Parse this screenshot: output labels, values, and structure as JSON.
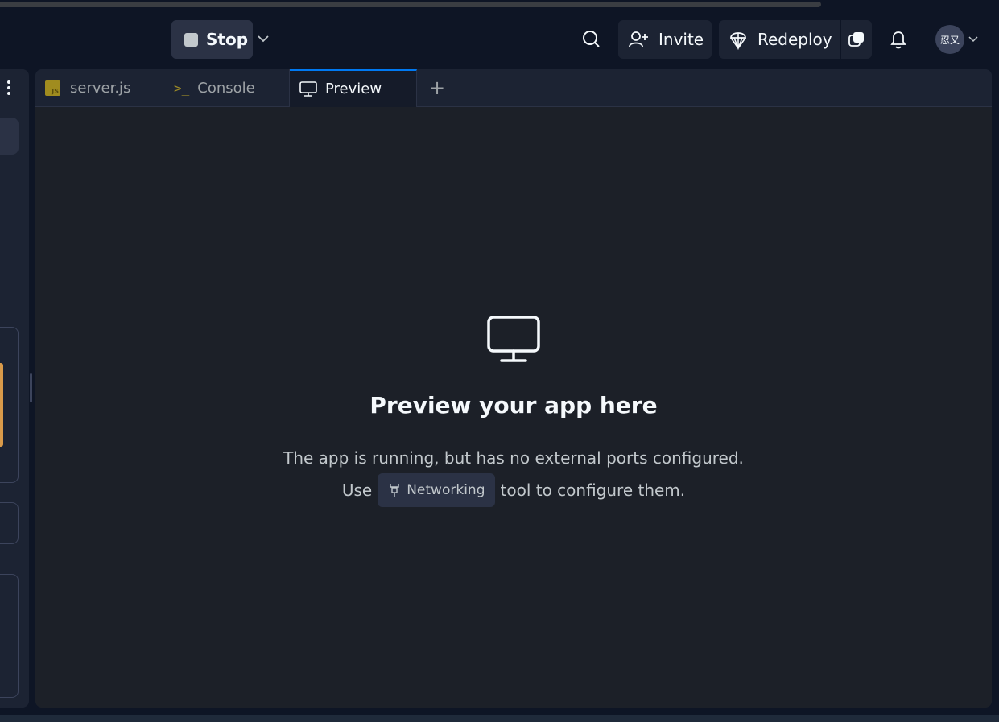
{
  "header": {
    "stop_label": "Stop",
    "invite_label": "Invite",
    "redeploy_label": "Redeploy",
    "avatar_text": "忍又"
  },
  "tabs": [
    {
      "label": "server.js",
      "icon": "js-file-icon"
    },
    {
      "label": "Console",
      "icon": "terminal-icon"
    },
    {
      "label": "Preview",
      "icon": "monitor-icon",
      "active": true
    }
  ],
  "add_tab_label": "+",
  "preview": {
    "title": "Preview your app here",
    "line1": "The app is running, but has no external ports configured.",
    "line2_prefix": "Use",
    "chip_label": "Networking",
    "line2_suffix": "tool to configure them."
  },
  "colors": {
    "accent": "#0079f2",
    "background": "#0e1525",
    "panel": "#1c2333"
  }
}
